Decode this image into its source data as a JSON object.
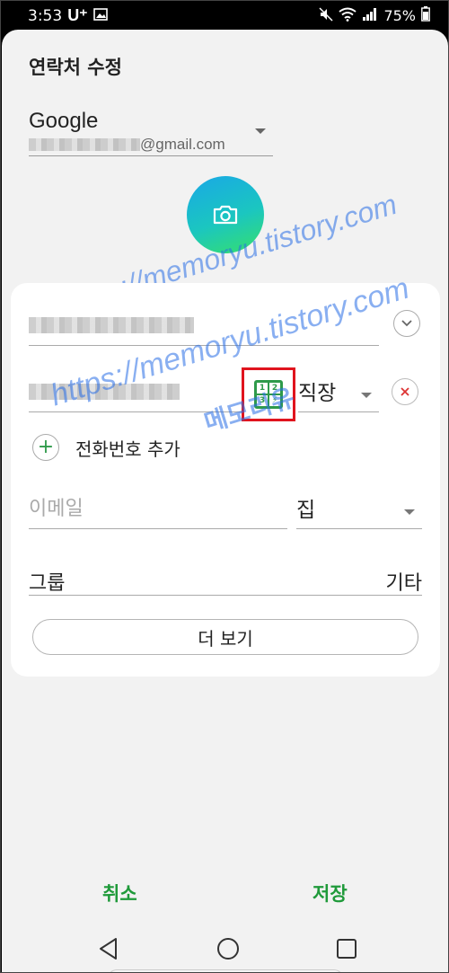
{
  "status_bar": {
    "time": "3:53",
    "carrier": "U⁺",
    "battery": "75%",
    "icons": [
      "image-icon",
      "mute-icon",
      "wifi-icon",
      "signal-icon",
      "battery-icon"
    ]
  },
  "page": {
    "title": "연락처 수정"
  },
  "account": {
    "name": "Google",
    "email_suffix": "@gmail.com"
  },
  "fields": {
    "phone_type": "직장",
    "add_phone_label": "전화번호 추가",
    "add_phone_icon": "plus-icon",
    "email_placeholder": "이메일",
    "email_type": "집",
    "group_label": "그룹",
    "group_value": "기타",
    "more_button": "더 보기",
    "dial_digits": [
      "1",
      "2",
      "3",
      "⚡"
    ]
  },
  "watermarks": {
    "url": "https://memoryu.tistory.com",
    "name": "메모리유"
  },
  "actions": {
    "cancel": "취소",
    "save": "저장"
  },
  "colors": {
    "accent_green": "#1f9a3a",
    "highlight_red": "#e0141e",
    "camera_gradient_start": "#19a8e6",
    "camera_gradient_end": "#36e06a"
  },
  "nav_bar": {
    "icons": [
      "back-icon",
      "home-icon",
      "recent-apps-icon"
    ]
  }
}
